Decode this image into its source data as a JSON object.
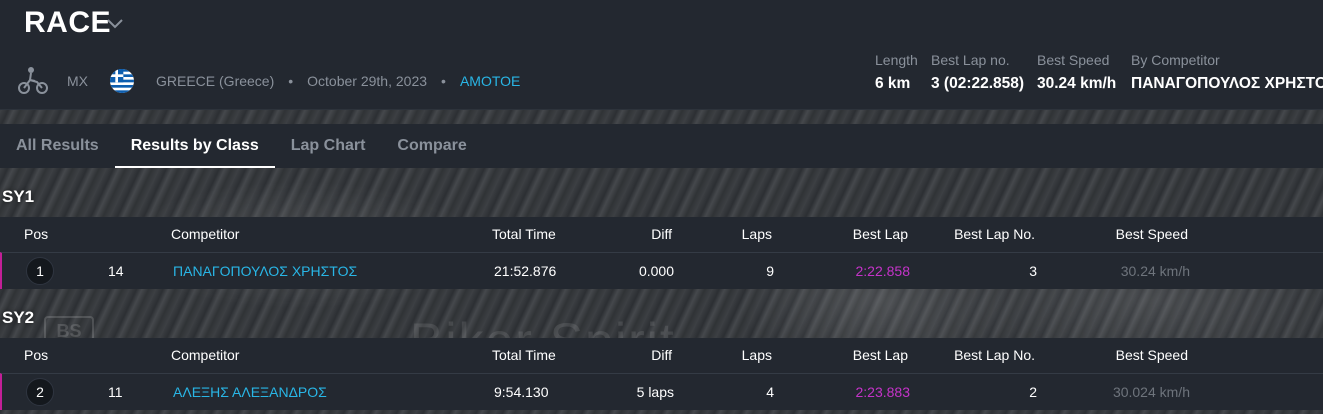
{
  "header": {
    "title": "RACE",
    "category": "MX",
    "country": "GREECE (Greece)",
    "date": "October 29th, 2023",
    "organizer": "ΑΜΟΤΟΕ",
    "separator": "•"
  },
  "stats": [
    {
      "label": "Length",
      "value": "6 km"
    },
    {
      "label": "Best Lap no.",
      "value": "3 (02:22.858)"
    },
    {
      "label": "Best Speed",
      "value": "30.24 km/h"
    },
    {
      "label": "By Competitor",
      "value": "ΠΑΝΑΓΟΠΟΥΛΟΣ ΧΡΗΣΤΟΣ"
    }
  ],
  "tabs": [
    {
      "label": "All Results",
      "active": false
    },
    {
      "label": "Results by Class",
      "active": true
    },
    {
      "label": "Lap Chart",
      "active": false
    },
    {
      "label": "Compare",
      "active": false
    }
  ],
  "columns": {
    "pos": "Pos",
    "competitor": "Competitor",
    "total_time": "Total Time",
    "diff": "Diff",
    "laps": "Laps",
    "best_lap": "Best Lap",
    "best_lap_no": "Best Lap No.",
    "best_speed": "Best Speed"
  },
  "classes": [
    {
      "name": "SY1",
      "rows": [
        {
          "pos": "1",
          "number": "14",
          "competitor": "ΠΑΝΑΓΟΠΟΥΛΟΣ ΧΡΗΣΤΟΣ",
          "total_time": "21:52.876",
          "diff": "0.000",
          "laps": "9",
          "best_lap": "2:22.858",
          "best_lap_no": "3",
          "best_speed": "30.24 km/h"
        }
      ]
    },
    {
      "name": "SY2",
      "rows": [
        {
          "pos": "2",
          "number": "11",
          "competitor": "ΑΛΕΞΗΣ ΑΛΕΞΑΝΔΡΟΣ",
          "total_time": "9:54.130",
          "diff": "5 laps",
          "laps": "4",
          "best_lap": "2:23.883",
          "best_lap_no": "2",
          "best_speed": "30.024 km/h"
        }
      ]
    }
  ],
  "watermark": {
    "text": "Biker Spirit",
    "logo": "BS"
  },
  "colors": {
    "accent": "#29b6e6",
    "best_lap": "#c533c9",
    "row_marker": "#c21f97",
    "panel": "#232830"
  }
}
